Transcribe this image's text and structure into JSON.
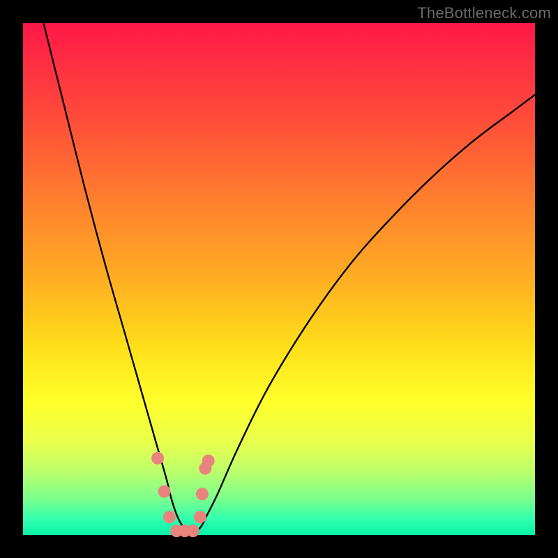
{
  "watermark": "TheBottleneck.com",
  "chart_data": {
    "type": "line",
    "title": "",
    "xlabel": "",
    "ylabel": "",
    "xlim": [
      0,
      100
    ],
    "ylim": [
      0,
      100
    ],
    "grid": false,
    "legend": false,
    "series": [
      {
        "name": "bottleneck-curve",
        "x": [
          4,
          8,
          12,
          16,
          20,
          24,
          26,
          28,
          29,
          30,
          31,
          32,
          34,
          35,
          36,
          38,
          42,
          48,
          56,
          64,
          72,
          80,
          88,
          96,
          100
        ],
        "values": [
          100,
          84,
          68,
          53,
          39,
          25,
          18,
          11,
          7,
          4,
          2,
          1,
          1,
          2,
          4,
          8,
          17,
          29,
          42,
          53,
          62,
          70,
          77,
          83,
          86
        ]
      }
    ],
    "markers": {
      "name": "highlight-dots",
      "color": "#e9837e",
      "x": [
        26.3,
        27.6,
        28.6,
        30.0,
        31.6,
        33.2,
        34.6,
        35.0,
        35.6,
        36.2
      ],
      "values": [
        15.0,
        8.5,
        3.5,
        0.8,
        0.8,
        0.8,
        3.5,
        8.0,
        13.0,
        14.5
      ]
    },
    "gradient_colors": {
      "top": "#ff1848",
      "mid_upper": "#ff7d2f",
      "mid": "#ffde1a",
      "mid_lower": "#b7ff6e",
      "bottom": "#05f3a8"
    }
  }
}
